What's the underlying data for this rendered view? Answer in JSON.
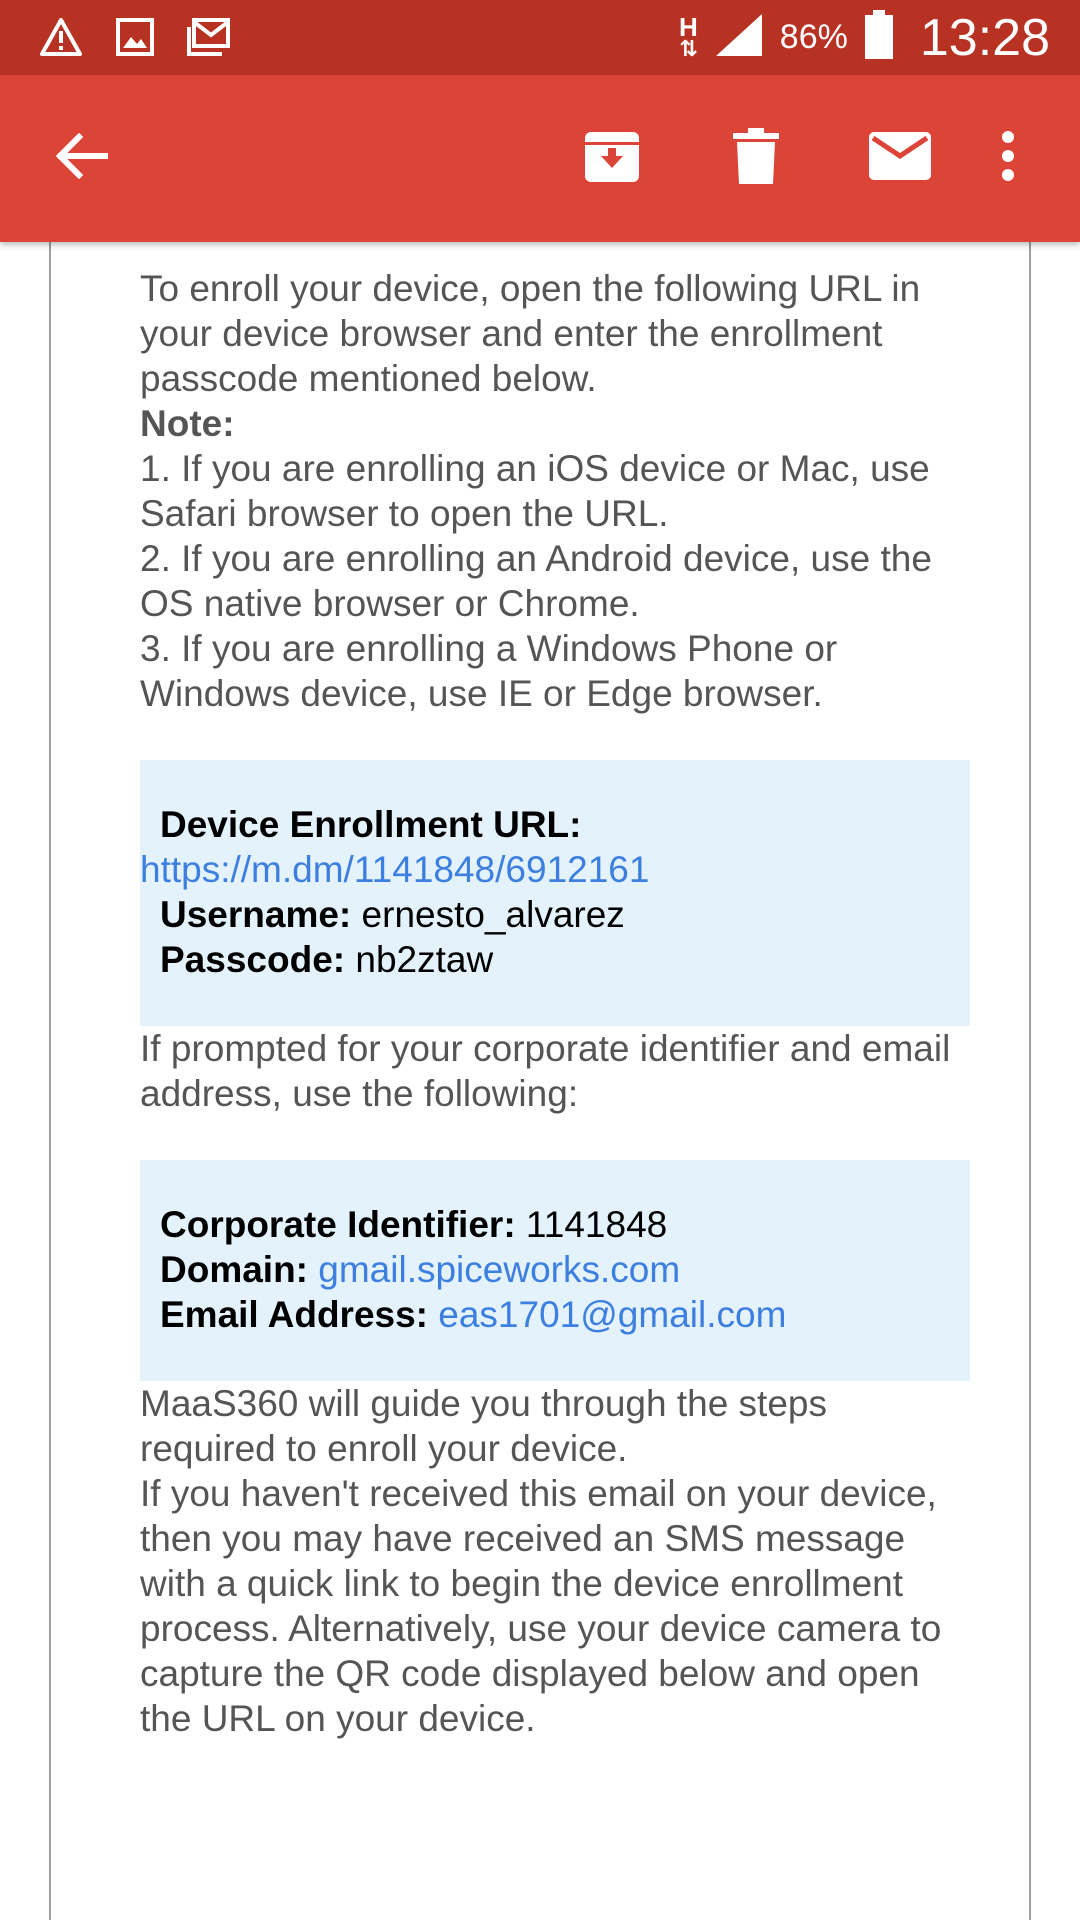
{
  "status_bar": {
    "network_type": "H",
    "battery": "86%",
    "time": "13:28",
    "icons": [
      "warning-icon",
      "image-icon",
      "gmail-icon",
      "signal-icon",
      "battery-icon"
    ]
  },
  "app_bar": {
    "color": "#db4437",
    "actions": [
      "back-arrow-icon",
      "archive-icon",
      "delete-icon",
      "mark-unread-icon",
      "more-vert-icon"
    ]
  },
  "email": {
    "intro": "To enroll your device, open the following URL in your device browser and enter the enrollment passcode mentioned below.",
    "note_label": "Note:",
    "notes": [
      "1. If you are enrolling an iOS device or Mac, use Safari browser to open the URL.",
      "2. If you are enrolling an Android device, use the OS native browser or Chrome.",
      "3. If you are enrolling a Windows Phone or Windows device, use IE or Edge browser."
    ],
    "enrollment_box": {
      "url_label": "Device Enrollment URL:",
      "url": "https://m.dm/1141848/6912161",
      "username_label": "Username:",
      "username": "ernesto_alvarez",
      "passcode_label": "Passcode:",
      "passcode": "nb2ztaw"
    },
    "corporate_prompt": "If prompted for your corporate identifier and email address, use the following:",
    "corporate_box": {
      "identifier_label": "Corporate Identifier:",
      "identifier": "1141848",
      "domain_label": "Domain:",
      "domain": "gmail.spiceworks.com",
      "email_label": "Email Address:",
      "email": "eas1701@gmail.com"
    },
    "guide_text": "MaaS360 will guide you through the steps required to enroll your device.",
    "sms_text": "If you haven't received this email on your device, then you may have received an SMS message with a quick link to begin the device enrollment process. Alternatively, use your device camera to capture the QR code displayed below and open the URL on your device."
  }
}
